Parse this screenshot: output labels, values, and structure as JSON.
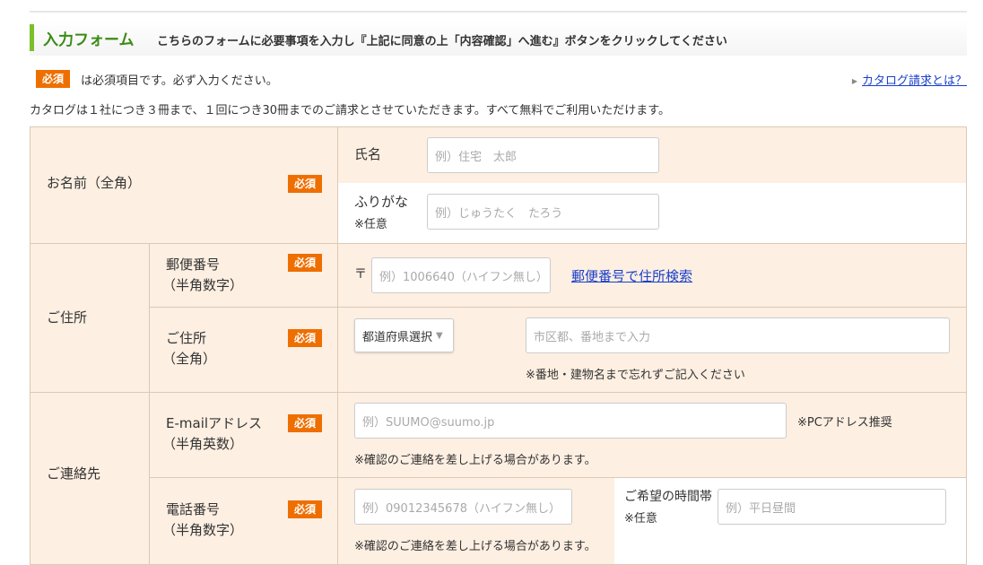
{
  "header": {
    "title": "入力フォーム",
    "description": "こちらのフォームに必要事項を入力し『上記に同意の上「内容確認」へ進む』ボタンをクリックしてください"
  },
  "required_badge": "必須",
  "required_note": "は必須項目です。必ず入力ください。",
  "catalog_link": "カタログ請求とは？",
  "catalog_info": "カタログは１社につき３冊まで、１回につき30冊までのご請求とさせていただきます。すべて無料でご利用いただけます。",
  "name_section": {
    "label": "お名前（全角）",
    "name_label": "氏名",
    "name_placeholder": "例）住宅　太郎",
    "furigana_label": "ふりがな",
    "furigana_optional": "※任意",
    "furigana_placeholder": "例）じゅうたく　たろう"
  },
  "address_section": {
    "label": "ご住所",
    "postal_label": "郵便番号",
    "postal_sub": "（半角数字）",
    "postal_mark": "〒",
    "postal_placeholder": "例）1006640（ハイフン無し）",
    "postal_search_link": "郵便番号で住所検索",
    "address_label": "ご住所",
    "address_sub": "（全角）",
    "prefecture_select": "都道府県選択",
    "address_placeholder": "市区都、番地まで入力",
    "address_note": "※番地・建物名まで忘れずご記入ください"
  },
  "contact_section": {
    "label": "ご連絡先",
    "email_label": "E-mailアドレス",
    "email_sub": "（半角英数）",
    "email_placeholder": "例）SUUMO@suumo.jp",
    "email_recommend": "※PCアドレス推奨",
    "email_note": "※確認のご連絡を差し上げる場合があります。",
    "phone_label": "電話番号",
    "phone_sub": "（半角数字）",
    "phone_placeholder": "例）09012345678（ハイフン無し）",
    "phone_note": "※確認のご連絡を差し上げる場合があります。",
    "time_label": "ご希望の時間帯",
    "time_optional": "※任意",
    "time_placeholder": "例）平日昼間"
  },
  "colors": {
    "accent_green": "#7bbf2a",
    "title_green": "#3c8a14",
    "badge_orange": "#ee6f00",
    "peach_bg": "#fdefe2",
    "link_blue": "#1a3fcc"
  }
}
